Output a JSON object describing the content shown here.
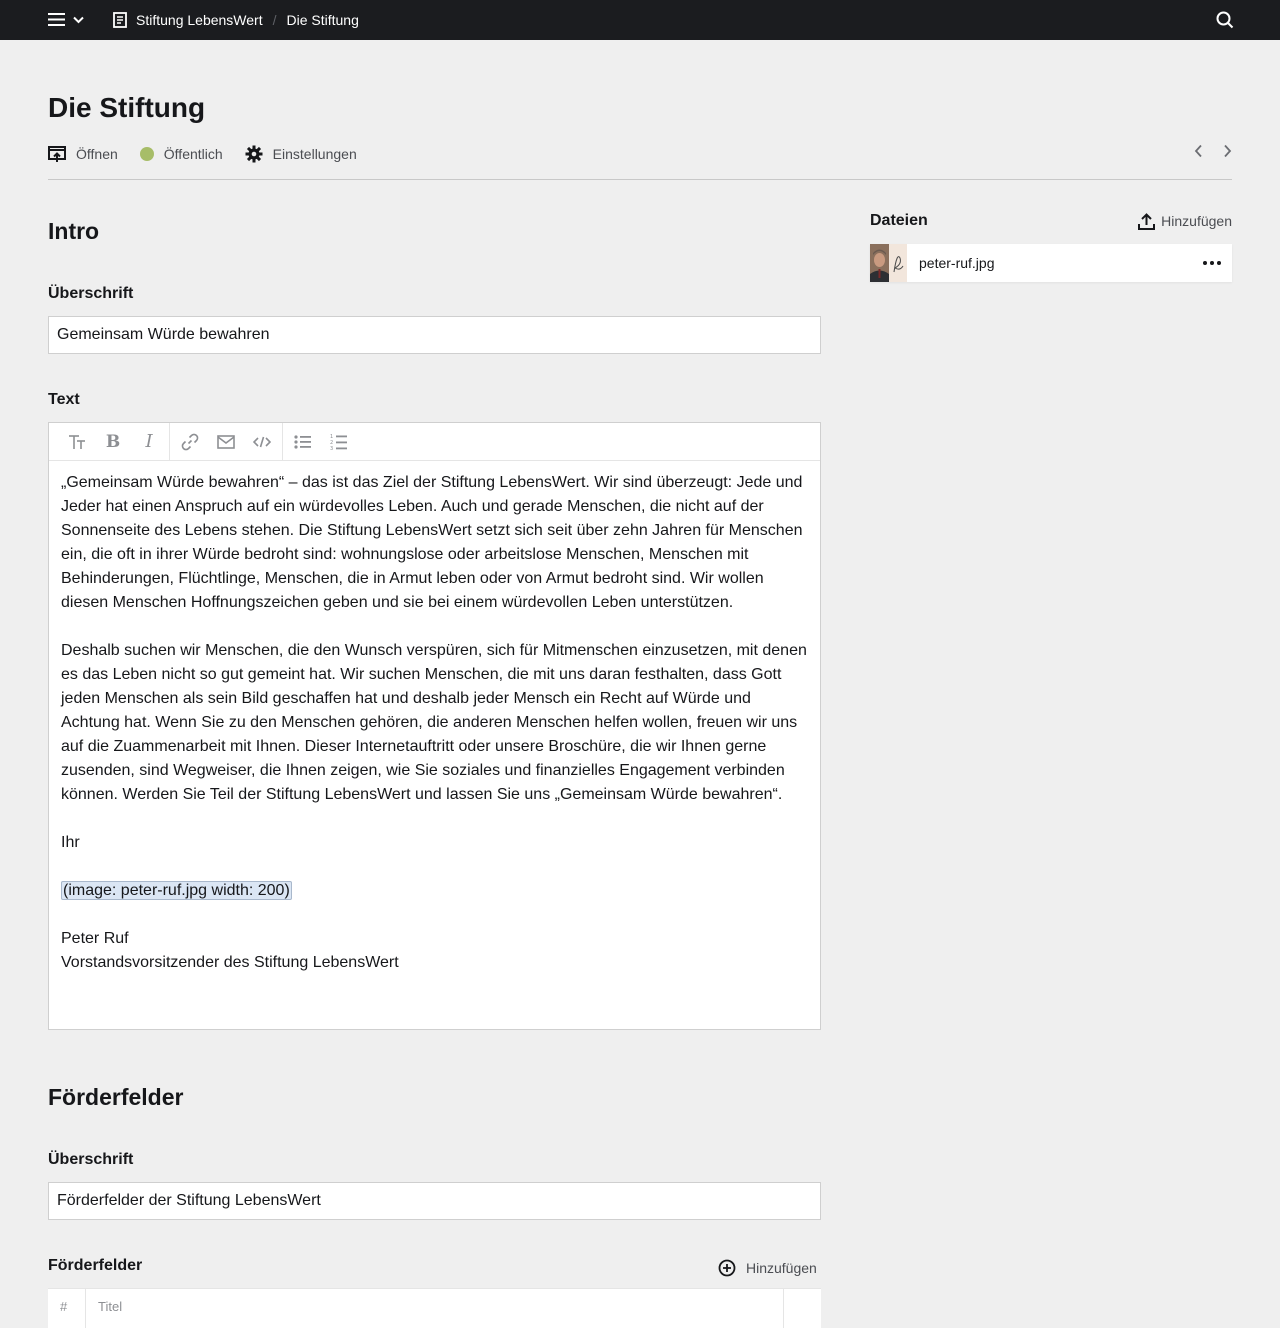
{
  "topbar": {
    "menu_icon": "hamburger-icon",
    "breadcrumb": [
      {
        "label": "Stiftung LebensWert",
        "icon": "page-icon"
      },
      {
        "label": "Die Stiftung"
      }
    ],
    "search_icon": "search-icon"
  },
  "page": {
    "title": "Die Stiftung",
    "actions": {
      "open": "Öffnen",
      "status": "Öffentlich",
      "settings": "Einstellungen"
    },
    "status_color": "#a7bd68"
  },
  "intro": {
    "section_title": "Intro",
    "heading_label": "Überschrift",
    "heading_value": "Gemeinsam Würde bewahren",
    "text_label": "Text",
    "paragraphs": [
      "„Gemeinsam Würde bewahren“ – das ist das Ziel der Stiftung LebensWert. Wir sind überzeugt: Jede und Jeder hat einen Anspruch auf ein würdevolles Leben. Auch und gerade Menschen, die nicht auf der Sonnenseite des Lebens stehen. Die Stiftung LebensWert setzt sich seit über zehn Jahren für Menschen ein, die oft in ihrer Würde bedroht sind: wohnungslose oder arbeitslose Menschen, Menschen mit Behinderungen, Flüchtlinge, Menschen, die in Armut leben oder von Armut bedroht sind. Wir wollen diesen Menschen Hoffnungszeichen geben und sie bei einem würdevollen Leben unterstützen.",
      "Deshalb suchen wir Menschen, die den Wunsch verspüren, sich für Mitmenschen einzusetzen, mit denen es das Leben nicht so gut gemeint hat. Wir suchen Menschen, die mit uns daran festhalten, dass Gott jeden Menschen als sein Bild geschaffen hat und deshalb jeder Mensch ein Recht auf Würde und Achtung hat. Wenn Sie zu den Menschen gehören, die anderen Menschen helfen wollen, freuen wir uns auf die Zuammenarbeit mit Ihnen. Dieser Internetauftritt oder unsere Broschüre, die wir Ihnen gerne zusenden, sind Wegweiser, die Ihnen zeigen, wie Sie soziales und finanzielles Engagement verbinden können. Werden Sie Teil der Stiftung LebensWert und lassen Sie uns „Gemeinsam Würde bewahren“.",
      "Ihr"
    ],
    "image_tag": "(image: peter-ruf.jpg width: 200)",
    "signature_name": "Peter Ruf",
    "signature_role": "Vorstandsvorsitzender des Stiftung LebensWert"
  },
  "files": {
    "title": "Dateien",
    "add_label": "Hinzufügen",
    "items": [
      {
        "name": "peter-ruf.jpg"
      }
    ]
  },
  "foerderfelder": {
    "section_title": "Förderfelder",
    "heading_label": "Überschrift",
    "heading_value": "Förderfelder der Stiftung LebensWert",
    "list_label": "Förderfelder",
    "add_label": "Hinzufügen",
    "columns": [
      "#",
      "Titel"
    ]
  }
}
